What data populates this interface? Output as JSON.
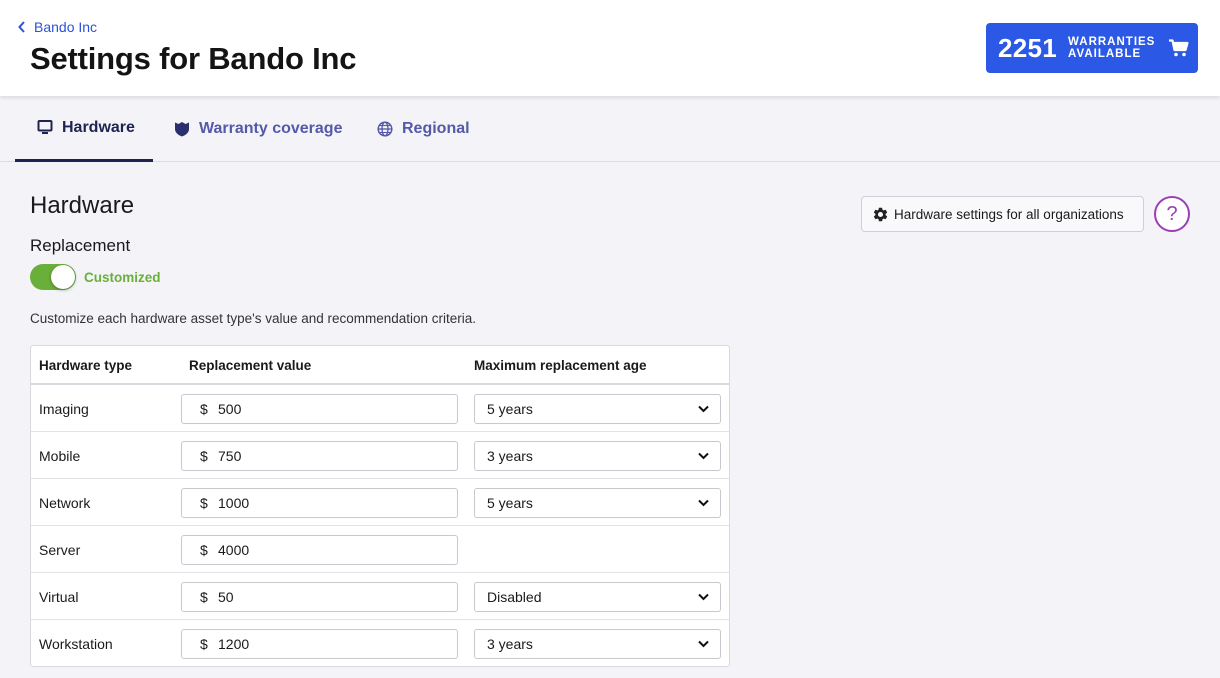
{
  "header": {
    "breadcrumb": "Bando Inc",
    "title": "Settings for Bando Inc",
    "warranties_count": "2251",
    "warranties_label_line1": "WARRANTIES",
    "warranties_label_line2": "AVAILABLE"
  },
  "tabs": [
    {
      "label": "Hardware",
      "icon": "monitor-icon",
      "active": true
    },
    {
      "label": "Warranty coverage",
      "icon": "shield-icon",
      "active": false
    },
    {
      "label": "Regional",
      "icon": "globe-icon",
      "active": false
    }
  ],
  "main": {
    "section_title": "Hardware",
    "subsection_title": "Replacement",
    "toggle_label": "Customized",
    "toggle_on": true,
    "description": "Customize each hardware asset type's value and recommendation criteria.",
    "settings_button": "Hardware settings for all organizations",
    "help_label": "?"
  },
  "table": {
    "columns": [
      "Hardware type",
      "Replacement value",
      "Maximum replacement age"
    ],
    "currency": "$",
    "rows": [
      {
        "type": "Imaging",
        "value": "500",
        "age": "5 years"
      },
      {
        "type": "Mobile",
        "value": "750",
        "age": "3 years"
      },
      {
        "type": "Network",
        "value": "1000",
        "age": "5 years"
      },
      {
        "type": "Server",
        "value": "4000",
        "age": null
      },
      {
        "type": "Virtual",
        "value": "50",
        "age": "Disabled"
      },
      {
        "type": "Workstation",
        "value": "1200",
        "age": "3 years"
      }
    ]
  },
  "colors": {
    "brand_blue": "#2b59e6",
    "tab_active": "#1f2352",
    "tab_inactive": "#5459a8",
    "toggle_green": "#6aaf3a",
    "help_purple": "#9b3fb5"
  }
}
